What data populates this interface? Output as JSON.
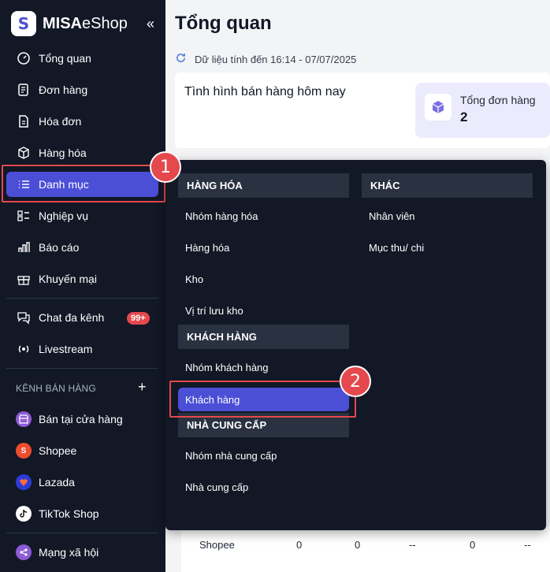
{
  "app": {
    "logo_letter": "S",
    "brand_bold": "MISA",
    "brand_rest": "eShop",
    "collapse_icon": "«"
  },
  "sidebar": {
    "items": [
      {
        "label": "Tổng quan",
        "icon": "dashboard-icon"
      },
      {
        "label": "Đơn hàng",
        "icon": "order-icon"
      },
      {
        "label": "Hóa đơn",
        "icon": "invoice-icon"
      },
      {
        "label": "Hàng hóa",
        "icon": "box-icon"
      },
      {
        "label": "Danh mục",
        "icon": "list-icon",
        "active": true
      },
      {
        "label": "Nghiệp vụ",
        "icon": "grid-list-icon"
      },
      {
        "label": "Báo cáo",
        "icon": "chart-icon"
      },
      {
        "label": "Khuyến mại",
        "icon": "gift-icon"
      }
    ],
    "chat": {
      "label": "Chat đa kênh",
      "badge": "99+"
    },
    "livestream": {
      "label": "Livestream"
    },
    "channels_title": "KÊNH BÁN HÀNG",
    "channels_add": "+",
    "channels": [
      {
        "label": "Bán tại cửa hàng",
        "color": "#8e5bd6"
      },
      {
        "label": "Shopee",
        "color": "#ee4d2d"
      },
      {
        "label": "Lazada",
        "color": "#2d3bd6"
      },
      {
        "label": "TikTok Shop",
        "color": "#ffffff"
      }
    ],
    "social": {
      "label": "Mạng xã hội",
      "color": "#8e5bd6"
    }
  },
  "main": {
    "title": "Tổng quan",
    "data_as_of": "Dữ liệu tính đến 16:14 - 07/07/2025",
    "sales_today_title": "Tình hình bán hàng hôm nay",
    "total_orders_label": "Tổng đơn hàng",
    "total_orders_value": "2",
    "bottom_row": {
      "channel": "Shopee",
      "cells": [
        "0",
        "0",
        "--",
        "0",
        "--"
      ]
    }
  },
  "dropdown": {
    "goods_header": "HÀNG HÓA",
    "goods_items": [
      "Nhóm hàng hóa",
      "Hàng hóa",
      "Kho",
      "Vị trí lưu kho"
    ],
    "customer_header": "KHÁCH HÀNG",
    "customer_items": [
      "Nhóm khách hàng",
      "Khách hàng"
    ],
    "supplier_header": "NHÀ CUNG CẤP",
    "supplier_items": [
      "Nhóm nhà cung cấp",
      "Nhà cung cấp"
    ],
    "other_header": "KHÁC",
    "other_items": [
      "Nhân viên",
      "Mục thu/ chi"
    ]
  },
  "steps": [
    "1",
    "2"
  ],
  "colors": {
    "sidebar_bg": "#121826",
    "accent": "#4b4fd6",
    "highlight": "#e5484d"
  }
}
